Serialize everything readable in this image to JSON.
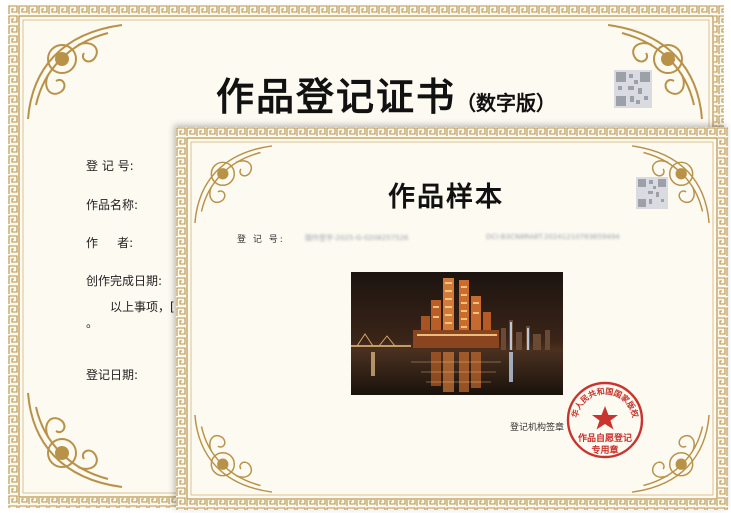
{
  "back_certificate": {
    "title": "作品登记证书",
    "title_suffix": "（数字版）",
    "fields": {
      "reg_no_label": "登 记 号:",
      "work_name_label": "作品名称:",
      "author_label": "作     者:",
      "completion_date_label": "创作完成日期:",
      "statement_fragment": "以上事项，[",
      "statement_end": "。",
      "reg_date_label": "登记日期:"
    }
  },
  "front_certificate": {
    "title": "作品样本",
    "reg_no_label": "登 记 号:",
    "reg_no_value": "国作登字-2025-G-0208257526",
    "doi_value": "DCI:B3CN8RA8T.20241210783659494",
    "sign_label": "登记机构签章",
    "seal": {
      "ring_text": "中华人民共和国国家版权局",
      "line1": "作品自愿登记",
      "line2": "专用章",
      "color": "#c9342f"
    }
  },
  "colors": {
    "border_gold": "#b9924a",
    "paper": "#fdfaf1"
  },
  "icons": [
    "qr-code-icon",
    "corner-flourish-icon",
    "seal-star-icon"
  ]
}
